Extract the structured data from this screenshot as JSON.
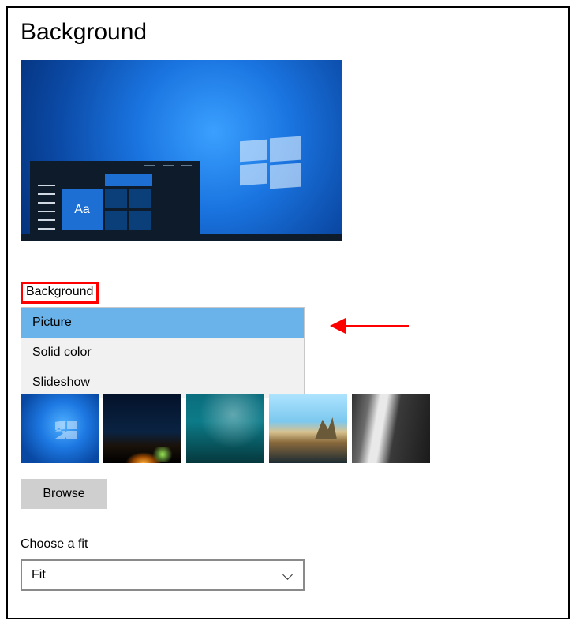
{
  "page_title": "Background",
  "preview": {
    "tile_text": "Aa"
  },
  "background_section": {
    "label": "Background",
    "options": [
      "Picture",
      "Solid color",
      "Slideshow"
    ],
    "selected": "Picture"
  },
  "thumbnails": [
    "windows-default-blue",
    "night-aurora",
    "underwater-teal",
    "beach-rock",
    "grey-waterfall-rock"
  ],
  "browse_label": "Browse",
  "fit_section": {
    "label": "Choose a fit",
    "value": "Fit"
  },
  "annotations": {
    "highlight": "red-box-around-background-label",
    "arrow": "points-to-picture-option"
  }
}
